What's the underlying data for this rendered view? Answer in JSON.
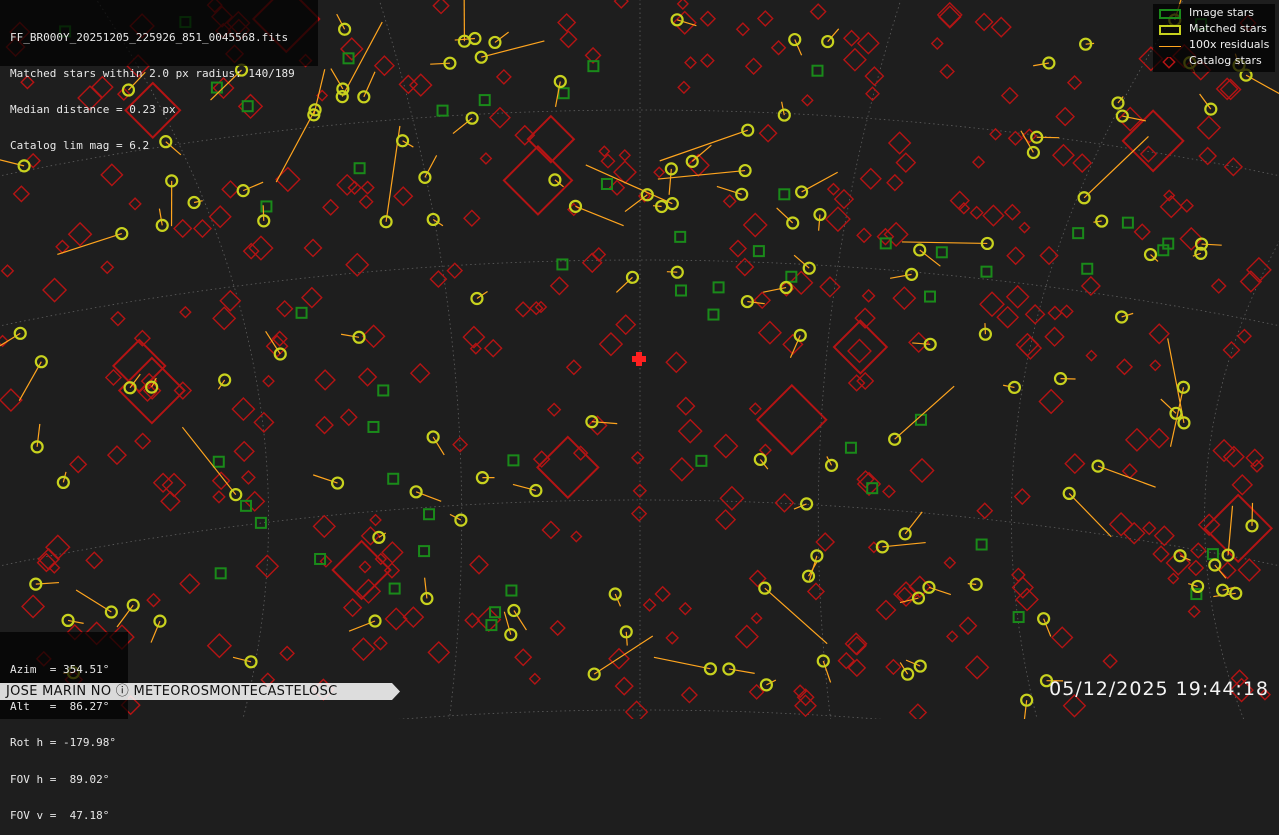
{
  "info": {
    "filename": "FF_BR000Y_20251205_225926_851_0045568.fits",
    "matched": "Matched stars within 2.0 px radius: 140/189",
    "median": "Median distance = 0.23 px",
    "limmag": "Catalog lim mag = 6.2"
  },
  "legend": {
    "image_stars": "Image stars",
    "matched_stars": "Matched stars",
    "residuals": "100x residuals",
    "catalog_stars": "Catalog stars"
  },
  "pointing": {
    "azim": "Azim  = 354.51°",
    "alt": "Alt   =  86.27°",
    "roth": "Rot h = -179.98°",
    "fovh": "FOV h =  89.02°",
    "fovv": "FOV v =  47.18°"
  },
  "watermark": "JOSE MARIN NO  ⓘ  METEOROSMONTECASTELOSC",
  "timestamp": "05/12/2025 19:44:18",
  "colors": {
    "image_star": "#1a8a1a",
    "matched_star": "#c8d21e",
    "residual": "#ffa51e",
    "catalog_star": "#b41414",
    "center_marker": "#ff2020"
  }
}
